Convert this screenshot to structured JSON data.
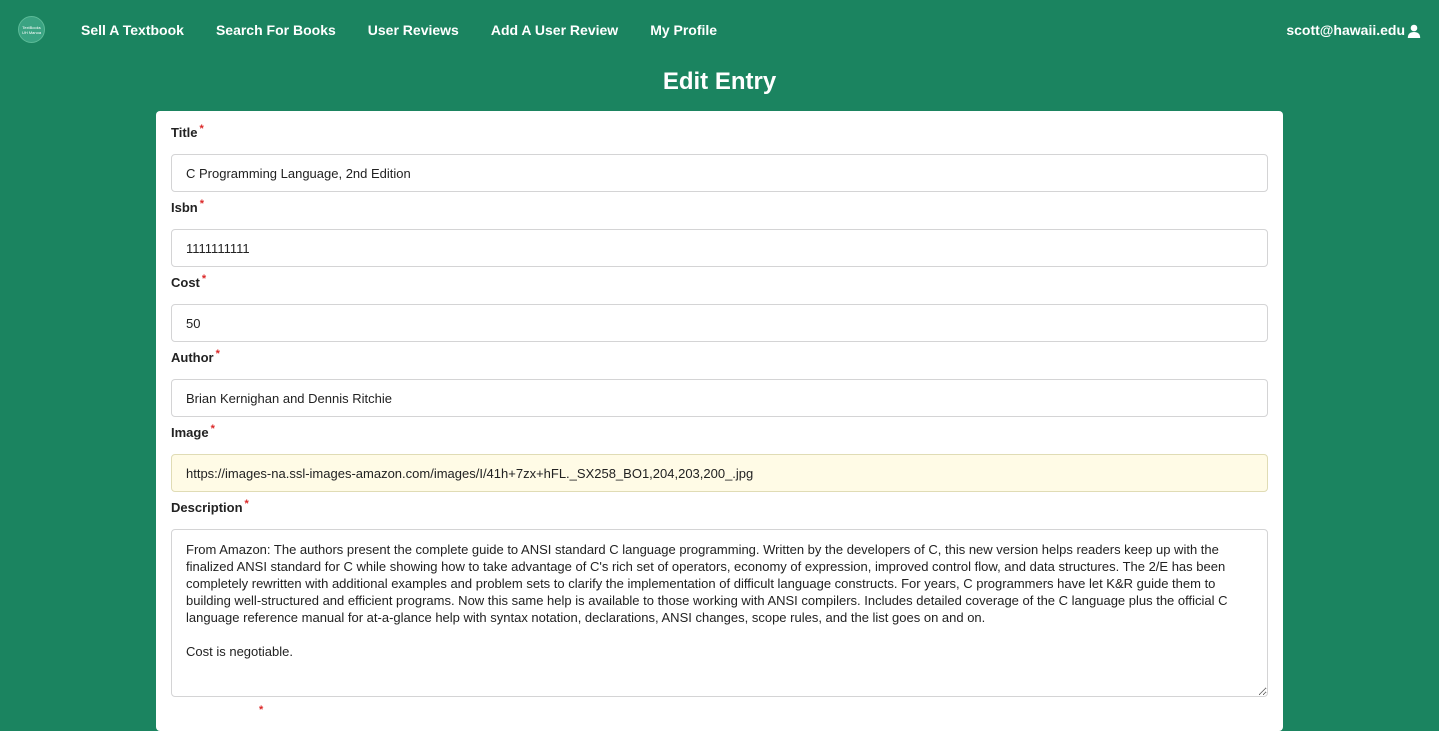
{
  "navbar": {
    "logo_text": "TextBooks UH Manoa",
    "links": [
      "Sell A Textbook",
      "Search For Books",
      "User Reviews",
      "Add A User Review",
      "My Profile"
    ],
    "user_email": "scott@hawaii.edu",
    "colors": {
      "background": "#1b8460",
      "text": "#ffffff"
    }
  },
  "page": {
    "title": "Edit Entry"
  },
  "form": {
    "required_marker": "*",
    "fields": {
      "title": {
        "label": "Title",
        "value": "C Programming Language, 2nd Edition"
      },
      "isbn": {
        "label": "Isbn",
        "value": "1111111111"
      },
      "cost": {
        "label": "Cost",
        "value": "50"
      },
      "author": {
        "label": "Author",
        "value": "Brian Kernighan and Dennis Ritchie"
      },
      "image": {
        "label": "Image",
        "value": "https://images-na.ssl-images-amazon.com/images/I/41h+7zx+hFL._SX258_BO1,204,203,200_.jpg"
      },
      "description": {
        "label": "Description",
        "value": "From Amazon: The authors present the complete guide to ANSI standard C language programming. Written by the developers of C, this new version helps readers keep up with the finalized ANSI standard for C while showing how to take advantage of C's rich set of operators, economy of expression, improved control flow, and data structures. The 2/E has been completely rewritten with additional examples and problem sets to clarify the implementation of difficult language constructs. For years, C programmers have let K&R guide them to building well-structured and efficient programs. Now this same help is available to those working with ANSI compilers. Includes detailed coverage of the C language plus the official C language reference manual for at-a-glance help with syntax notation, declarations, ANSI changes, scope rules, and the list goes on and on.\n\nCost is negotiable."
      }
    }
  }
}
